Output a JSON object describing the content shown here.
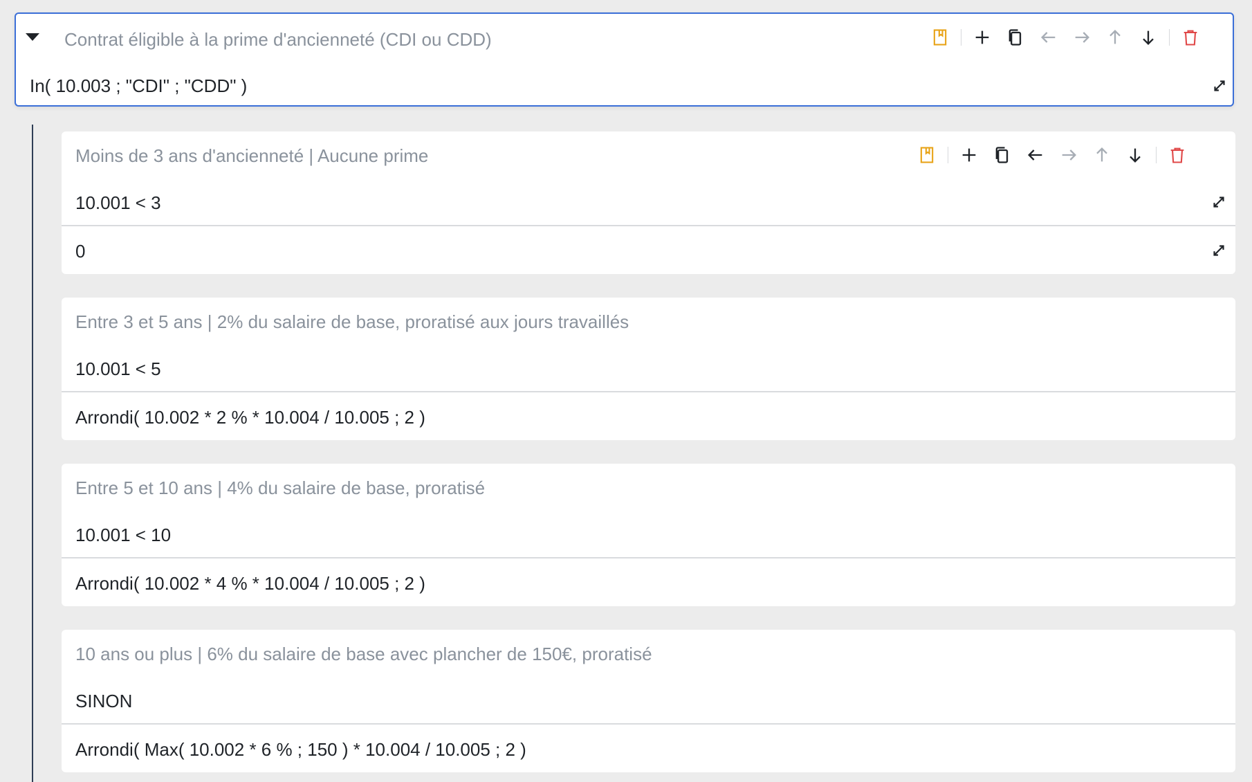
{
  "parent": {
    "title": "Contrat éligible à la prime d'ancienneté (CDI ou CDD)",
    "condition": "In( 10.003 ; \"CDI\" ; \"CDD\" )"
  },
  "toolbar": {
    "bookmark_icon": "bookmark-icon",
    "add_icon": "plus-icon",
    "duplicate_icon": "duplicate-icon",
    "outdent_icon": "arrow-left-icon",
    "indent_icon": "arrow-right-icon",
    "move_up_icon": "arrow-up-icon",
    "move_down_icon": "arrow-down-icon",
    "delete_icon": "trash-icon"
  },
  "children": [
    {
      "title": "Moins de 3 ans d'ancienneté | Aucune prime",
      "condition": "10.001 < 3",
      "result": "0"
    },
    {
      "title": "Entre 3 et 5 ans | 2% du salaire de base, proratisé aux jours travaillés",
      "condition": "10.001 < 5",
      "result": "Arrondi( 10.002 * 2 % * 10.004 / 10.005 ; 2 )"
    },
    {
      "title": "Entre 5 et 10 ans | 4% du salaire de base, proratisé",
      "condition": "10.001 < 10",
      "result": "Arrondi( 10.002 * 4 % * 10.004 / 10.005 ; 2 )"
    },
    {
      "title": "10 ans ou plus | 6% du salaire de base avec plancher de 150€, proratisé",
      "condition": "SINON",
      "result": "Arrondi( Max( 10.002 * 6 % ; 150 ) * 10.004 / 10.005 ; 2 )"
    }
  ],
  "colors": {
    "accent_border": "#3b6fd8",
    "bookmark": "#e8a317",
    "delete": "#e04848",
    "disabled_arrow": "#a7adb5",
    "text": "#1f2328",
    "title_gray": "#8a929c"
  }
}
